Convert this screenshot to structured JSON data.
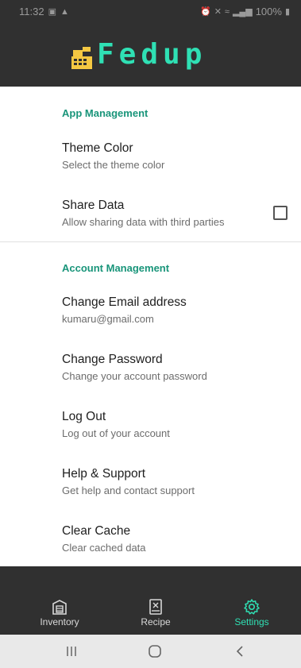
{
  "status_bar": {
    "time": "11:32",
    "battery": "100%"
  },
  "app": {
    "logo_text": "Fedup"
  },
  "sections": [
    {
      "title": "App Management",
      "items": [
        {
          "title": "Theme Color",
          "summary": "Select the theme color"
        },
        {
          "title": "Share Data",
          "summary": "Allow sharing data with third parties",
          "checked": false
        }
      ]
    },
    {
      "title": "Account Management",
      "items": [
        {
          "title": "Change Email address",
          "summary": "kumaru@gmail.com"
        },
        {
          "title": "Change Password",
          "summary": "Change your account password"
        },
        {
          "title": "Log Out",
          "summary": "Log out of your account"
        },
        {
          "title": "Help & Support",
          "summary": "Get help and contact support"
        },
        {
          "title": "Clear Cache",
          "summary": "Clear cached data"
        }
      ]
    }
  ],
  "bottom_nav": {
    "items": [
      {
        "label": "Inventory",
        "icon": "inventory-icon",
        "active": false
      },
      {
        "label": "Recipe",
        "icon": "recipe-icon",
        "active": false
      },
      {
        "label": "Settings",
        "icon": "settings-icon",
        "active": true
      }
    ]
  },
  "colors": {
    "accent": "#2fe0b4",
    "section_title": "#19957a",
    "bar_background": "#303030"
  }
}
